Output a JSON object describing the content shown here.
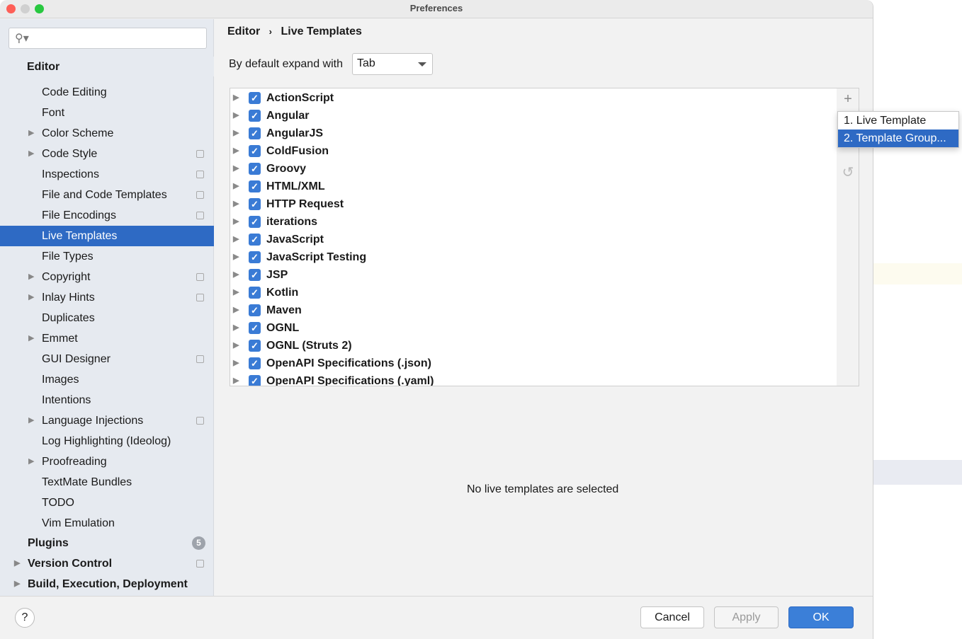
{
  "window": {
    "title": "Preferences"
  },
  "sidebar": {
    "search_placeholder": "",
    "header": "Editor",
    "items": [
      {
        "label": "Code Editing",
        "expand": false,
        "cfg": false
      },
      {
        "label": "Font",
        "expand": false,
        "cfg": false
      },
      {
        "label": "Color Scheme",
        "expand": true,
        "cfg": false
      },
      {
        "label": "Code Style",
        "expand": true,
        "cfg": true
      },
      {
        "label": "Inspections",
        "expand": false,
        "cfg": true
      },
      {
        "label": "File and Code Templates",
        "expand": false,
        "cfg": true
      },
      {
        "label": "File Encodings",
        "expand": false,
        "cfg": true
      },
      {
        "label": "Live Templates",
        "expand": false,
        "cfg": false,
        "selected": true
      },
      {
        "label": "File Types",
        "expand": false,
        "cfg": false
      },
      {
        "label": "Copyright",
        "expand": true,
        "cfg": true
      },
      {
        "label": "Inlay Hints",
        "expand": true,
        "cfg": true
      },
      {
        "label": "Duplicates",
        "expand": false,
        "cfg": false
      },
      {
        "label": "Emmet",
        "expand": true,
        "cfg": false
      },
      {
        "label": "GUI Designer",
        "expand": false,
        "cfg": true
      },
      {
        "label": "Images",
        "expand": false,
        "cfg": false
      },
      {
        "label": "Intentions",
        "expand": false,
        "cfg": false
      },
      {
        "label": "Language Injections",
        "expand": true,
        "cfg": true
      },
      {
        "label": "Log Highlighting (Ideolog)",
        "expand": false,
        "cfg": false
      },
      {
        "label": "Proofreading",
        "expand": true,
        "cfg": false
      },
      {
        "label": "TextMate Bundles",
        "expand": false,
        "cfg": false
      },
      {
        "label": "TODO",
        "expand": false,
        "cfg": false
      },
      {
        "label": "Vim Emulation",
        "expand": false,
        "cfg": false
      }
    ],
    "top_items": [
      {
        "label": "Plugins",
        "expand": false,
        "badge": "5"
      },
      {
        "label": "Version Control",
        "expand": true,
        "cfg": true
      },
      {
        "label": "Build, Execution, Deployment",
        "expand": true
      }
    ]
  },
  "main": {
    "breadcrumb": [
      "Editor",
      "Live Templates"
    ],
    "expand_label": "By default expand with",
    "expand_value": "Tab",
    "groups": [
      "ActionScript",
      "Angular",
      "AngularJS",
      "ColdFusion",
      "Groovy",
      "HTML/XML",
      "HTTP Request",
      "iterations",
      "JavaScript",
      "JavaScript Testing",
      "JSP",
      "Kotlin",
      "Maven",
      "OGNL",
      "OGNL (Struts 2)",
      "OpenAPI Specifications (.json)",
      "OpenAPI Specifications (.yaml)"
    ],
    "empty_text": "No live templates are selected"
  },
  "popup": {
    "items": [
      "1. Live Template",
      "2. Template Group..."
    ],
    "highlighted": 1
  },
  "footer": {
    "help": "?",
    "cancel": "Cancel",
    "apply": "Apply",
    "ok": "OK"
  },
  "colors": {
    "accent": "#2e6ac4",
    "checkbox": "#3a7bd5"
  }
}
